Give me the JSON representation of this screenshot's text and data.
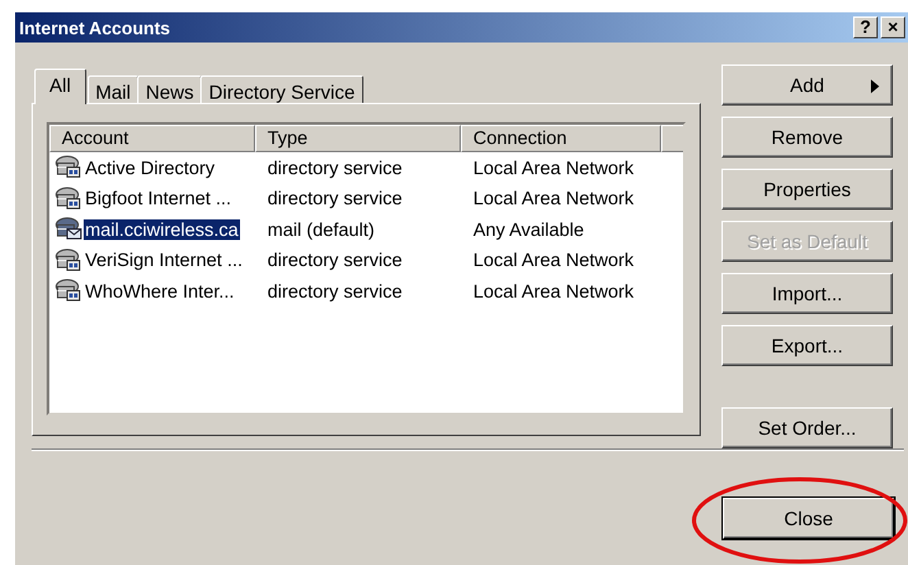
{
  "window": {
    "title": "Internet Accounts",
    "title_buttons": [
      "?",
      "×"
    ]
  },
  "tabs": [
    {
      "label": "All",
      "selected": true
    },
    {
      "label": "Mail",
      "selected": false
    },
    {
      "label": "News",
      "selected": false
    },
    {
      "label": "Directory Service",
      "selected": false
    }
  ],
  "table": {
    "columns": [
      "Account",
      "Type",
      "Connection"
    ],
    "rows": [
      {
        "kind": "directory",
        "account": "Active Directory",
        "type": "directory service",
        "connection": "Local Area Network",
        "selected": false
      },
      {
        "kind": "directory",
        "account": "Bigfoot Internet ...",
        "type": "directory service",
        "connection": "Local Area Network",
        "selected": false
      },
      {
        "kind": "mail",
        "account": "mail.cciwireless.ca",
        "type": "mail (default)",
        "connection": "Any Available",
        "selected": true
      },
      {
        "kind": "directory",
        "account": "VeriSign Internet ...",
        "type": "directory service",
        "connection": "Local Area Network",
        "selected": false
      },
      {
        "kind": "directory",
        "account": "WhoWhere Inter...",
        "type": "directory service",
        "connection": "Local Area Network",
        "selected": false
      }
    ]
  },
  "buttons": [
    {
      "label": "Add",
      "kind": "menu",
      "disabled": false
    },
    {
      "label": "Remove",
      "kind": "plain",
      "disabled": false
    },
    {
      "label": "Properties",
      "kind": "plain",
      "disabled": false
    },
    {
      "label": "Set as Default",
      "kind": "plain",
      "disabled": true
    },
    {
      "label": "Import...",
      "kind": "plain",
      "disabled": false
    },
    {
      "label": "Export...",
      "kind": "plain",
      "disabled": false
    },
    {
      "label": "Set Order...",
      "kind": "spaced",
      "disabled": false
    }
  ],
  "close_button": {
    "label": "Close",
    "highlighted": true
  }
}
